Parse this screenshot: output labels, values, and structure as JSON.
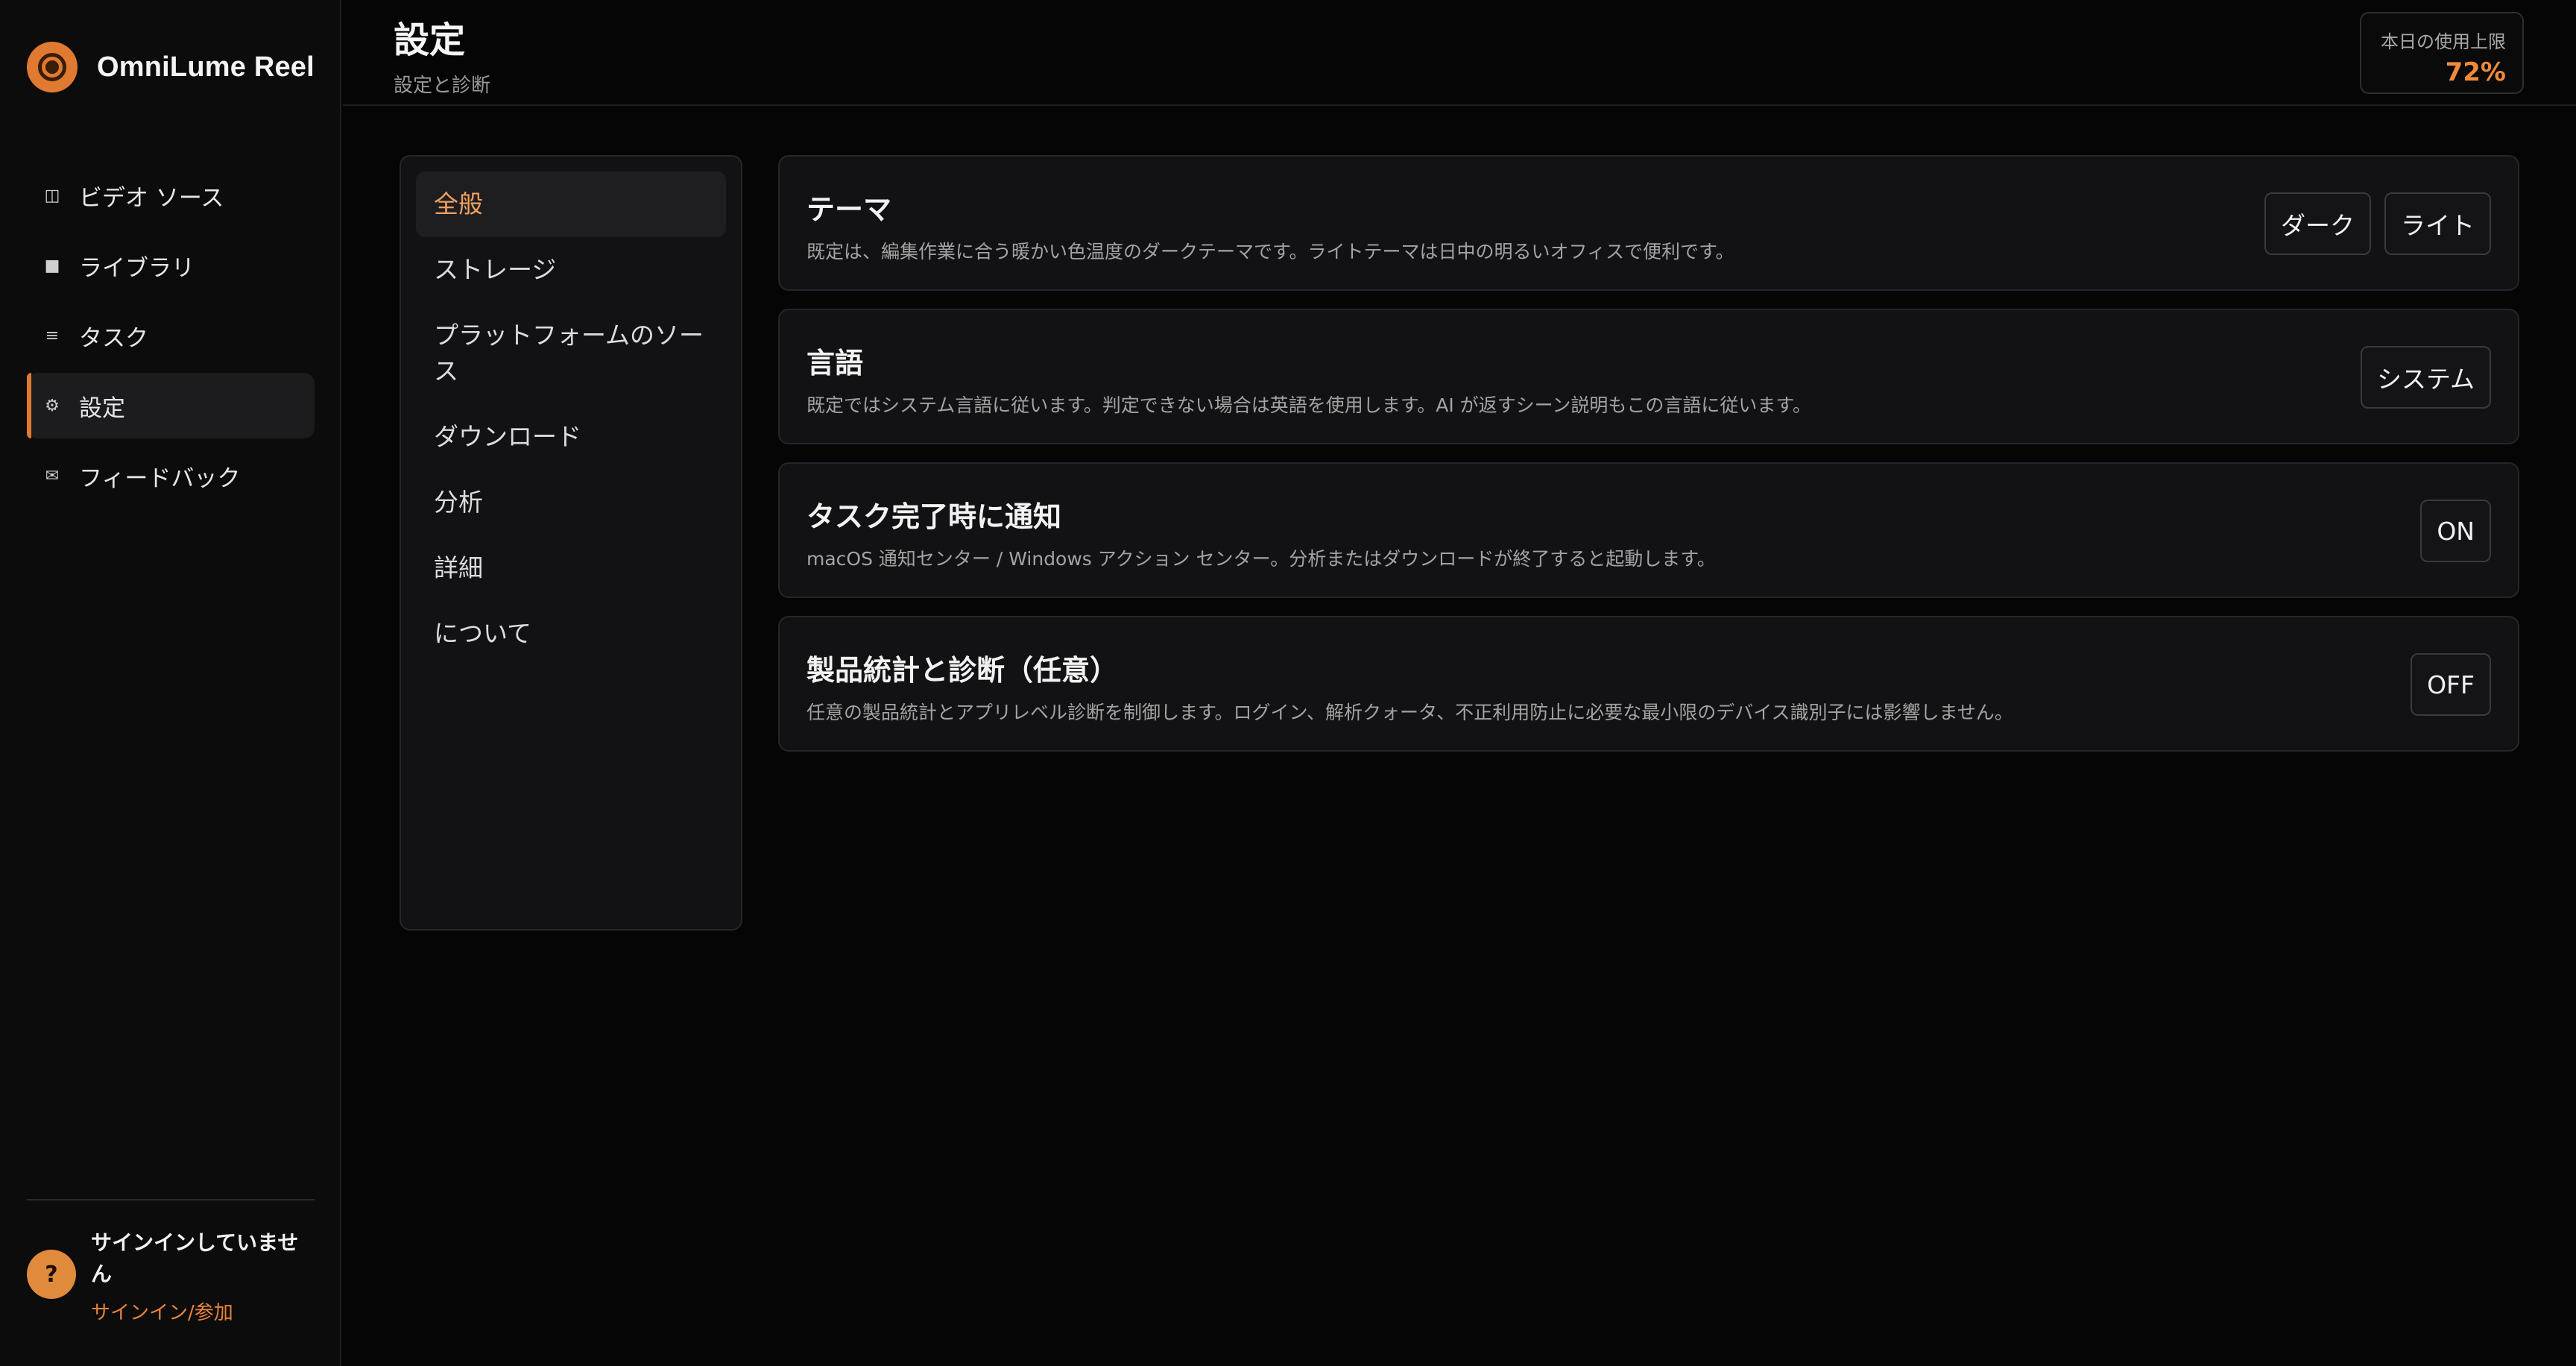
{
  "app": {
    "name": "OmniLume Reel"
  },
  "sidebar": {
    "items": [
      {
        "label": "ビデオ ソース",
        "icon": "video-source-icon",
        "glyph": "◫"
      },
      {
        "label": "ライブラリ",
        "icon": "library-icon",
        "glyph": "■"
      },
      {
        "label": "タスク",
        "icon": "tasks-icon",
        "glyph": "≡"
      },
      {
        "label": "設定",
        "icon": "gear-icon",
        "glyph": "⚙"
      },
      {
        "label": "フィードバック",
        "icon": "mail-icon",
        "glyph": "✉"
      }
    ],
    "active_index": 3,
    "account": {
      "avatar": "?",
      "status": "サインインしていません",
      "link": "サインイン/参加"
    }
  },
  "header": {
    "title": "設定",
    "subtitle": "設定と診断",
    "usage": {
      "label": "本日の使用上限",
      "value": "72%"
    }
  },
  "settings_nav": {
    "items": [
      "全般",
      "ストレージ",
      "プラットフォームのソース",
      "ダウンロード",
      "分析",
      "詳細",
      "について"
    ],
    "active_index": 0
  },
  "settings": {
    "theme": {
      "title": "テーマ",
      "desc": "既定は、編集作業に合う暖かい色温度のダークテーマです。ライトテーマは日中の明るいオフィスで便利です。",
      "options": [
        "ダーク",
        "ライト"
      ]
    },
    "language": {
      "title": "言語",
      "desc": "既定ではシステム言語に従います。判定できない場合は英語を使用します。AI が返すシーン説明もこの言語に従います。",
      "value": "システム"
    },
    "notify": {
      "title": "タスク完了時に通知",
      "desc": "macOS 通知センター / Windows アクション センター。分析またはダウンロードが終了すると起動します。",
      "value": "ON"
    },
    "telemetry": {
      "title": "製品統計と診断（任意）",
      "desc": "任意の製品統計とアプリレベル診断を制御します。ログイン、解析クォータ、不正利用防止に必要な最小限のデバイス識別子には影響しません。",
      "value": "OFF"
    }
  },
  "colors": {
    "accent": "#e07a30",
    "background": "#050505",
    "panel": "#121214"
  }
}
